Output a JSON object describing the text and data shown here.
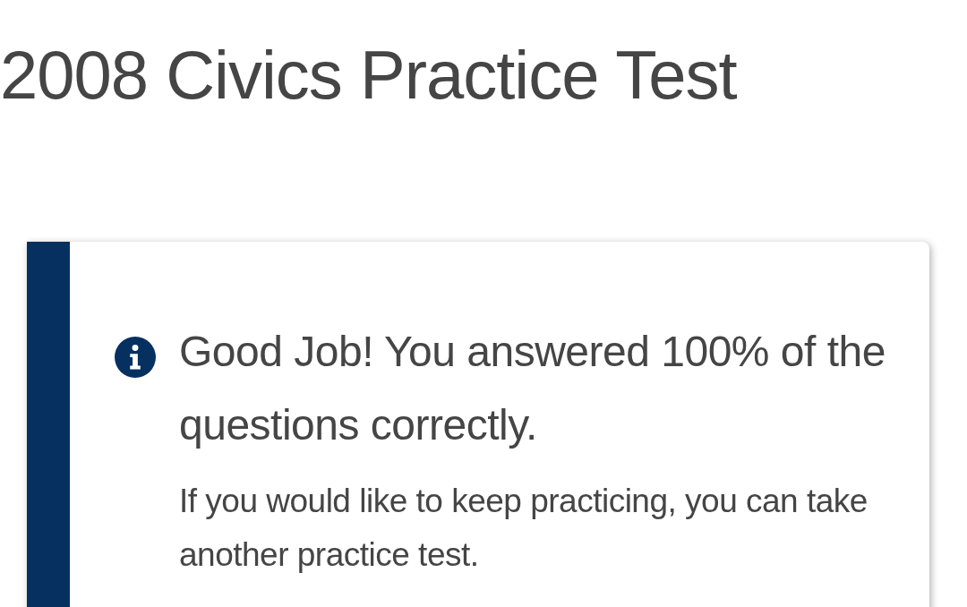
{
  "page": {
    "title": "2008 Civics Practice Test"
  },
  "alert": {
    "kind": "info",
    "heading": "Good Job! You answered 100% of the questions correctly.",
    "message": "If you would like to keep practicing, you can take another practice test."
  }
}
